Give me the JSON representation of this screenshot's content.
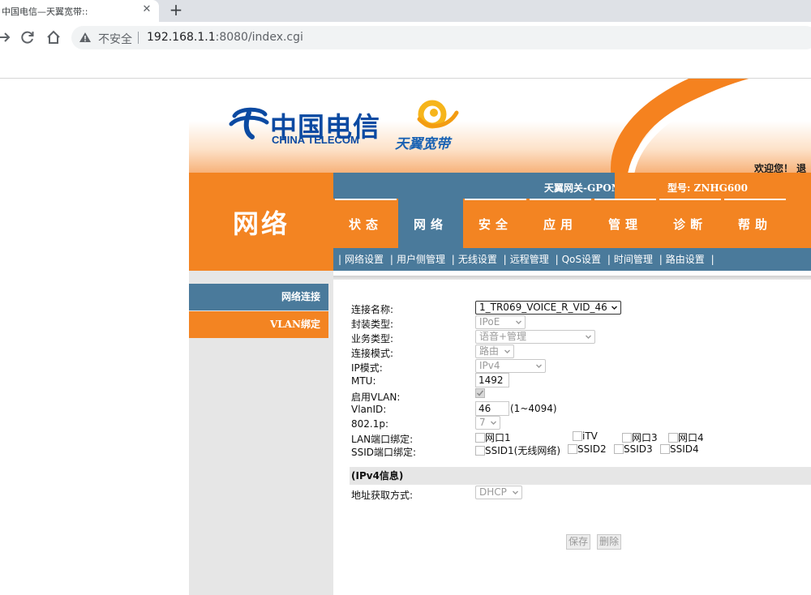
{
  "browser": {
    "tab_title": "中国电信—天翼宽带::",
    "close_glyph": "✕",
    "new_tab_glyph": "+",
    "insecure_label": "不安全",
    "url_host": "192.168.1.1",
    "url_path": ":8080/index.cgi"
  },
  "banner": {
    "brand_cn": "中国电信",
    "brand_en": "CHINA TELECOM",
    "tianyi": "天翼宽带",
    "welcome": "欢迎您！ 退"
  },
  "header": {
    "section_title": "网络",
    "gateway": "天翼网关-GPON",
    "model": "型号: ZNHG600"
  },
  "main_nav": [
    {
      "label": "状态"
    },
    {
      "label": "网络"
    },
    {
      "label": "安全"
    },
    {
      "label": "应用"
    },
    {
      "label": "管理"
    },
    {
      "label": "诊断"
    },
    {
      "label": "帮助"
    }
  ],
  "sub_nav": [
    "网络设置",
    "用户侧管理",
    "无线设置",
    "远程管理",
    "QoS设置",
    "时间管理",
    "路由设置"
  ],
  "side_menu": [
    {
      "label": "网络连接"
    },
    {
      "label": "VLAN绑定"
    }
  ],
  "form": {
    "conn_name_label": "连接名称:",
    "conn_name_value": "1_TR069_VOICE_R_VID_46",
    "encap_label": "封装类型:",
    "encap_value": "IPoE",
    "service_label": "业务类型:",
    "service_value": "语音+管理",
    "mode_label": "连接模式:",
    "mode_value": "路由",
    "ipmode_label": "IP模式:",
    "ipmode_value": "IPv4",
    "mtu_label": "MTU:",
    "mtu_value": "1492",
    "vlan_enable_label": "启用VLAN:",
    "vlanid_label": "VlanID:",
    "vlanid_value": "46",
    "vlanid_range": "(1~4094)",
    "dot1p_label": "802.1p:",
    "dot1p_value": "7",
    "lan_bind_label": "LAN端口绑定:",
    "lan_ports": [
      "网口1",
      "iTV",
      "网口3",
      "网口4"
    ],
    "ssid_bind_label": "SSID端口绑定:",
    "ssids": [
      "SSID1(无线网络)",
      "SSID2",
      "SSID3",
      "SSID4"
    ],
    "ipv4_section": "(IPv4信息)",
    "addr_mode_label": "地址获取方式:",
    "addr_mode_value": "DHCP",
    "save_label": "保存",
    "delete_label": "删除"
  },
  "colors": {
    "orange": "#f38422",
    "steel_blue": "#4a7a9b",
    "brand_blue": "#0b4aa2"
  }
}
